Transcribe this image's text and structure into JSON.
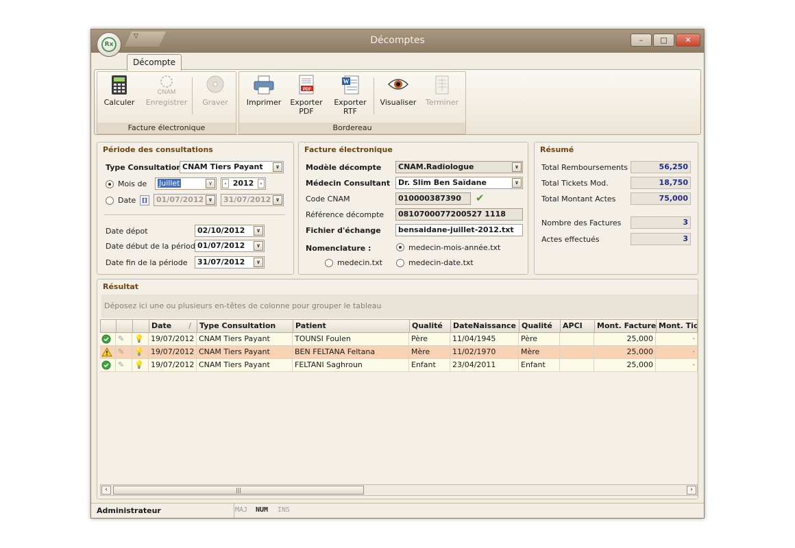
{
  "window": {
    "title": "Décomptes"
  },
  "app_button": {
    "label": "Rx"
  },
  "tabs": [
    {
      "label": "Décompte"
    }
  ],
  "ribbon": {
    "facture_group": {
      "label": "Facture électronique",
      "buttons": [
        {
          "label": "Calculer",
          "enabled": true
        },
        {
          "label": "Enregistrer",
          "enabled": false
        },
        {
          "label": "Graver",
          "enabled": false
        }
      ],
      "cnam_icon_text": "CNAM"
    },
    "bordereau_group": {
      "label": "Bordereau",
      "buttons": [
        {
          "label": "Imprimer",
          "enabled": true
        },
        {
          "label": "Exporter",
          "label2": "PDF",
          "enabled": true
        },
        {
          "label": "Exporter",
          "label2": "RTF",
          "enabled": true
        },
        {
          "label": "Visualiser",
          "enabled": true
        },
        {
          "label": "Terminer",
          "enabled": false
        }
      ]
    }
  },
  "periode": {
    "title": "Période des consultations",
    "type_label": "Type Consultation",
    "type_value": "CNAM Tiers Payant",
    "mois_label": "Mois de",
    "mois_value": "Juillet",
    "year_value": "2012",
    "date_label": "Date",
    "date_from": "01/07/2012",
    "date_to": "31/07/2012",
    "depot_label": "Date dépot",
    "depot_value": "02/10/2012",
    "debut_label": "Date début de la période",
    "debut_value": "01/07/2012",
    "fin_label": "Date fin de la période",
    "fin_value": "31/07/2012"
  },
  "facture": {
    "title": "Facture électronique",
    "modele_label": "Modèle décompte",
    "modele_value": "CNAM.Radiologue",
    "medecin_label": "Médecin Consultant",
    "medecin_value": "Dr. Slim Ben Saïdane",
    "code_label": "Code CNAM",
    "code_value": "010000387390",
    "ref_label": "Référence décompte",
    "ref_value": "0810700077200527 1118",
    "fichier_label": "Fichier d'échange",
    "fichier_value": "bensaidane-juillet-2012.txt",
    "nomenclature_label": "Nomenclature :",
    "opt1": "medecin-mois-année.txt",
    "opt2": "medecin.txt",
    "opt3": "medecin-date.txt"
  },
  "resume": {
    "title": "Résumé",
    "items": [
      {
        "label": "Total Remboursements",
        "value": "56,250"
      },
      {
        "label": "Total Tickets Mod.",
        "value": "18,750"
      },
      {
        "label": "Total Montant Actes",
        "value": "75,000"
      },
      {
        "label": "Nombre des Factures",
        "value": "3"
      },
      {
        "label": "Actes effectués",
        "value": "3"
      }
    ]
  },
  "resultat": {
    "title": "Résultat",
    "group_hint": "Déposez ici une ou plusieurs en-têtes de colonne pour grouper le tableau",
    "columns": [
      "Date",
      "Type Consultation",
      "Patient",
      "Qualité",
      "DateNaissance",
      "Qualité",
      "APCI",
      "Mont. Facture",
      "Mont. Tick"
    ],
    "rows": [
      {
        "status": "ok",
        "date": "19/07/2012",
        "type": "CNAM Tiers Payant",
        "patient": "TOUNSI Foulen",
        "qualite": "Père",
        "naissance": "11/04/1945",
        "qualite2": "Père",
        "apci": "",
        "montant": "25,000"
      },
      {
        "status": "warn",
        "date": "19/07/2012",
        "type": "CNAM Tiers Payant",
        "patient": "BEN FELTANA Feltana",
        "qualite": "Mère",
        "naissance": "11/02/1970",
        "qualite2": "Mère",
        "apci": "",
        "montant": "25,000"
      },
      {
        "status": "ok",
        "date": "19/07/2012",
        "type": "CNAM Tiers Payant",
        "patient": "FELTANI Saghroun",
        "qualite": "Enfant",
        "naissance": "23/04/2011",
        "qualite2": "Enfant",
        "apci": "",
        "montant": "25,000"
      }
    ]
  },
  "statusbar": {
    "user": "Administrateur",
    "maj": "MAJ",
    "num": "NUM",
    "ins": "INS"
  }
}
